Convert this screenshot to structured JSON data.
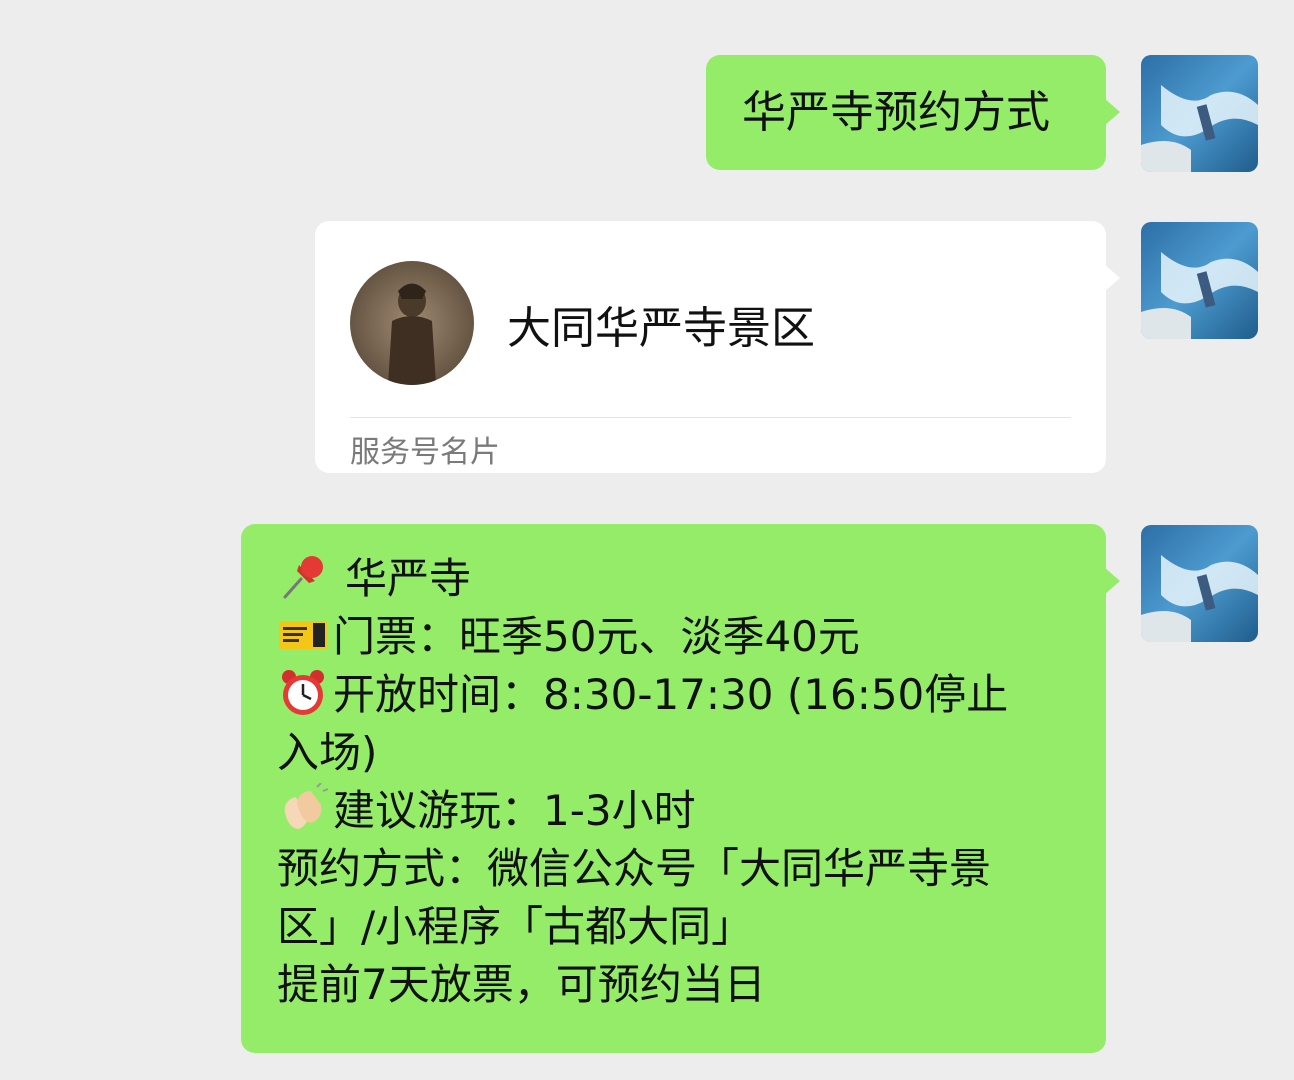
{
  "messages": [
    {
      "id": "msg1",
      "type": "text",
      "text": "华严寺预约方式"
    },
    {
      "id": "msg2",
      "type": "card",
      "name": "大同华严寺景区",
      "card_type": "服务号名片"
    },
    {
      "id": "msg3",
      "type": "text",
      "lines": {
        "title": "华严寺",
        "ticket": "门票：旺季50元、淡季40元",
        "hours_1": "开放时间：8:30-17:30 (16:50停止",
        "hours_2": "入场)",
        "duration": "建议游玩：1-3小时",
        "booking_1": "预约方式：微信公众号「大同华严寺景",
        "booking_2": "区」/小程序「古都大同」",
        "release": "提前7天放票，可预约当日"
      },
      "icons": [
        "pushpin-icon",
        "ticket-icon",
        "alarm-clock-icon",
        "clapping-hands-icon"
      ]
    }
  ],
  "colors": {
    "background": "#ededed",
    "sent_bubble": "#95ec69",
    "card_bubble": "#ffffff"
  }
}
